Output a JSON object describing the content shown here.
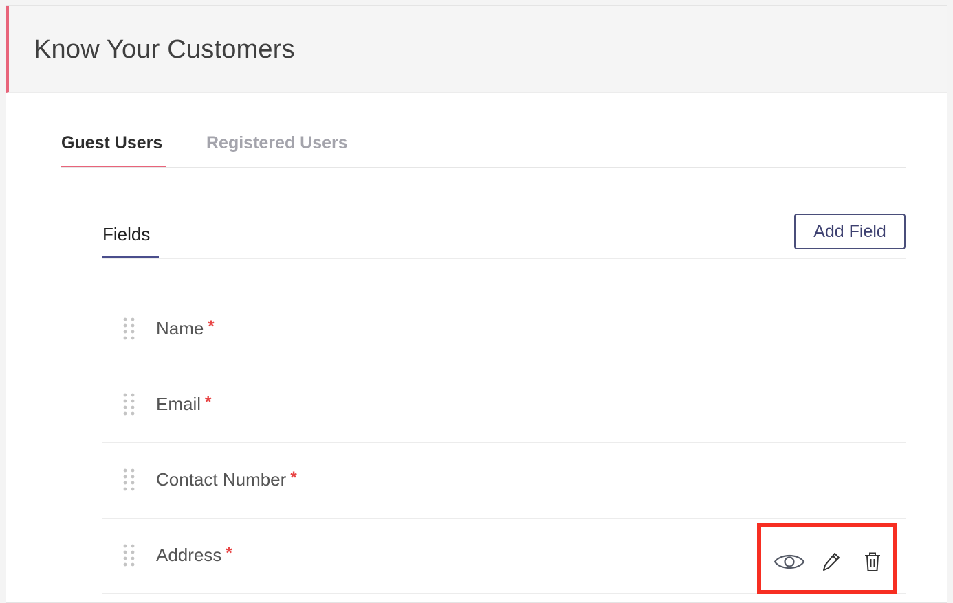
{
  "page": {
    "title": "Know Your Customers"
  },
  "tabs": [
    {
      "label": "Guest Users",
      "active": true
    },
    {
      "label": "Registered Users",
      "active": false
    }
  ],
  "fields_section": {
    "title": "Fields",
    "add_button_label": "Add Field"
  },
  "fields": [
    {
      "label": "Name",
      "required_mark": "*"
    },
    {
      "label": "Email",
      "required_mark": "*"
    },
    {
      "label": "Contact Number",
      "required_mark": "*"
    },
    {
      "label": "Address",
      "required_mark": "*"
    }
  ],
  "row_actions": {
    "icons": [
      "eye-icon",
      "pencil-icon",
      "trash-icon"
    ],
    "highlight_color": "#f72e22"
  },
  "colors": {
    "accent": "#e8647a",
    "primary": "#4a4e7a",
    "required": "#e84545"
  }
}
